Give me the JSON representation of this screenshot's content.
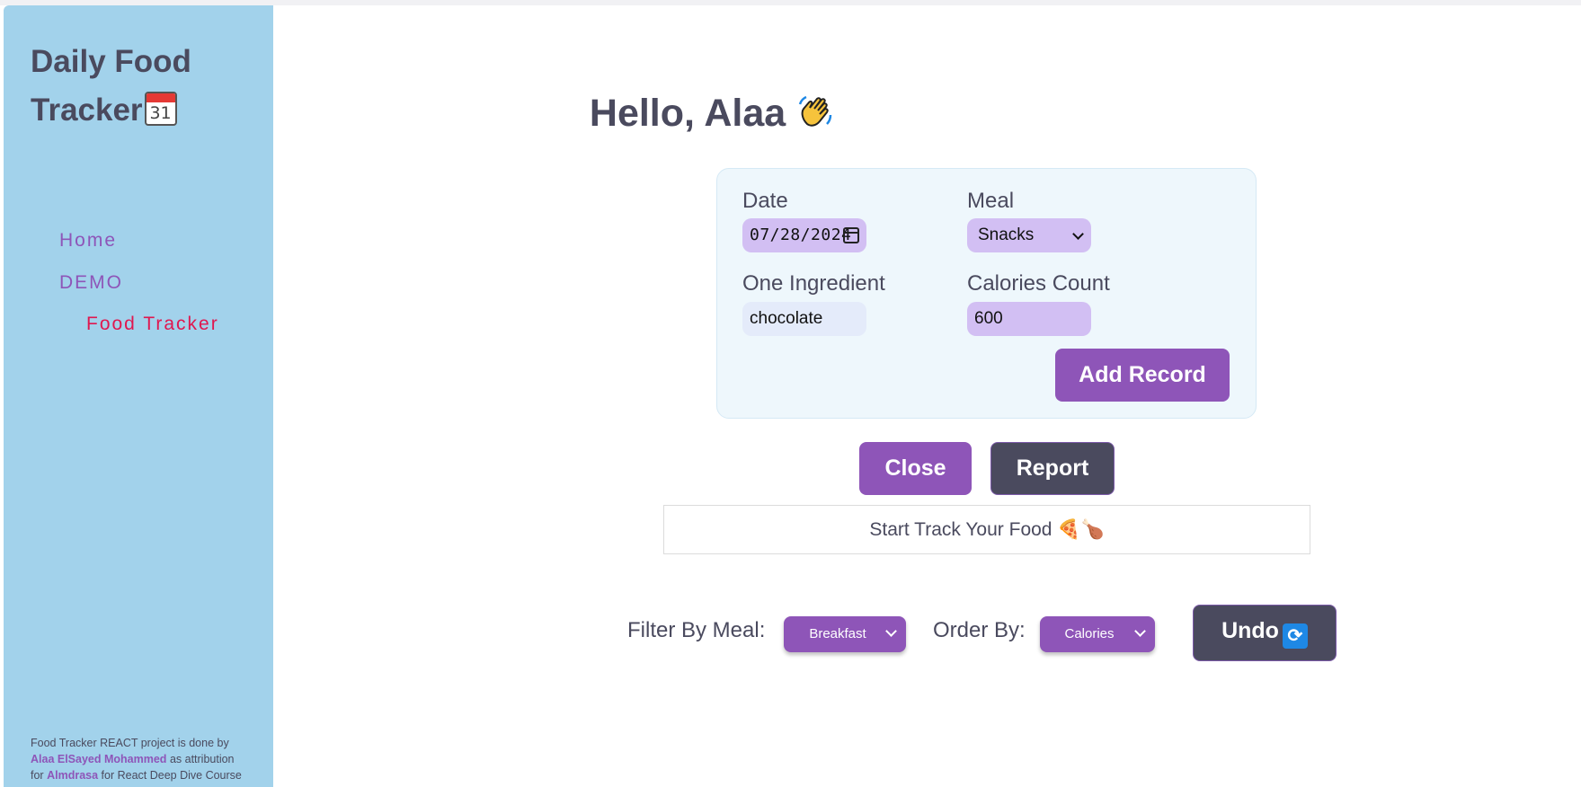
{
  "sidebar": {
    "brand_line1": "Daily Food",
    "brand_line2": "Tracker",
    "brand_icon": "calendar-icon",
    "brand_icon_text": "31",
    "nav": {
      "home": "Home",
      "demo": "DEMO",
      "food_tracker": "Food Tracker"
    },
    "attribution": {
      "line1": "Food Tracker REACT project is done by",
      "author": "Alaa ElSayed Mohammed",
      "mid": "as attribution",
      "for": "for",
      "org": "Almdrasa",
      "tail": "for React Deep Dive Course"
    }
  },
  "main": {
    "greeting": "Hello, Alaa",
    "greeting_icon": "waving-hand-icon",
    "form": {
      "date_label": "Date",
      "date_value": "07/28/2024",
      "meal_label": "Meal",
      "meal_value": "Snacks",
      "ingredient_label": "One Ingredient",
      "ingredient_value": "chocolate",
      "calories_label": "Calories Count",
      "calories_value": "600",
      "add_button": "Add Record"
    },
    "close_button": "Close",
    "report_button": "Report",
    "tracker_message": "Start Track Your Food",
    "tracker_message_icons": "🍕🍗",
    "filter_label": "Filter By Meal:",
    "filter_value": "Breakfast",
    "order_label": "Order By:",
    "order_value": "Calories",
    "undo_button": "Undo",
    "undo_icon": "repeat-icon"
  },
  "colors": {
    "sidebar_bg": "#a2d2eb",
    "accent_purple": "#8e55b8",
    "dark_button": "#4a4a5e",
    "active_nav": "#e0174f",
    "card_bg": "#eef7fc"
  }
}
